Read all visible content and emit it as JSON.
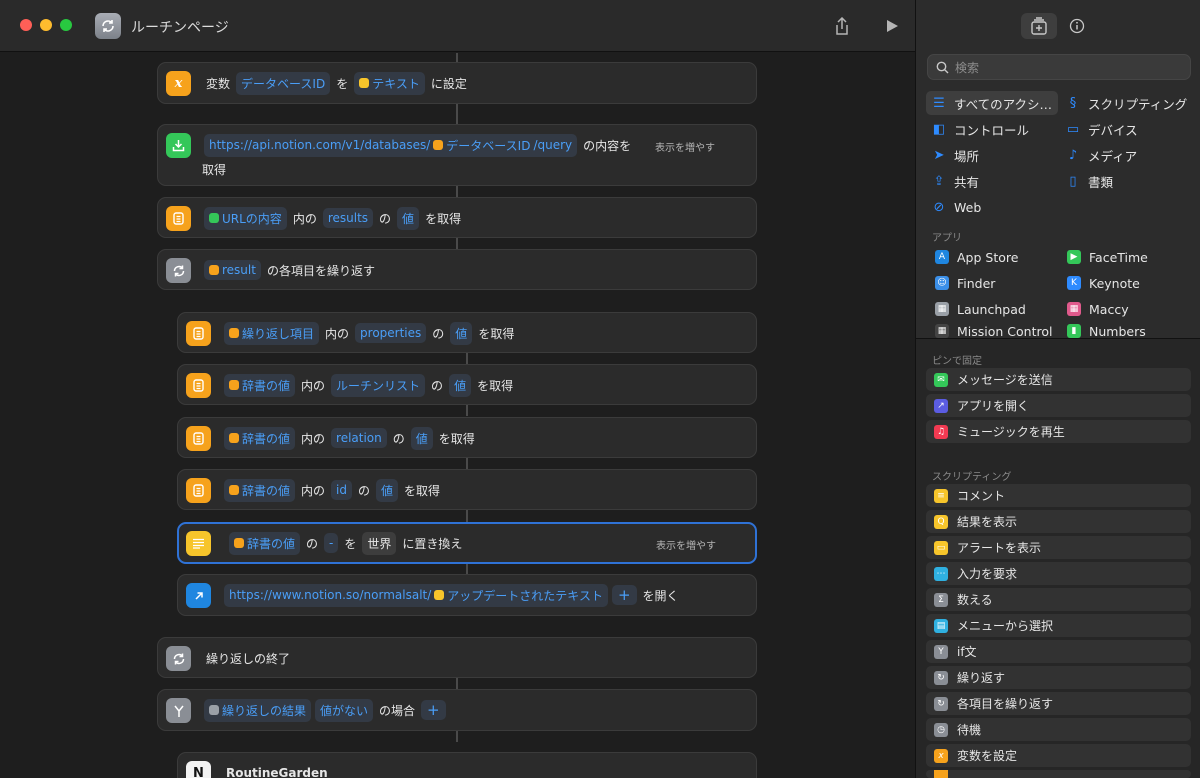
{
  "window": {
    "title": "ルーチンページ"
  },
  "actions": {
    "set_variable": {
      "label1": "変数",
      "var": "データベースID",
      "label2": "を",
      "value": "テキスト",
      "label3": "に設定"
    },
    "get_url": {
      "url": "https://api.notion.com/v1/databases/",
      "var": "データベースID",
      "suffix": "/query",
      "label1": "の内容を",
      "label2": "取得",
      "more": "表示を増やす"
    },
    "get_dict_results": {
      "var": "URLの内容",
      "label1": "内の",
      "key": "results",
      "label2": "の",
      "kind": "値",
      "label3": "を取得"
    },
    "repeat_each": {
      "var": "result",
      "label": "の各項目を繰り返す"
    },
    "get_properties": {
      "var": "繰り返し項目",
      "label1": "内の",
      "key": "properties",
      "label2": "の",
      "kind": "値",
      "label3": "を取得"
    },
    "get_routine_list": {
      "var": "辞書の値",
      "label1": "内の",
      "key": "ルーチンリスト",
      "label2": "の",
      "kind": "値",
      "label3": "を取得"
    },
    "get_relation": {
      "var": "辞書の値",
      "label1": "内の",
      "key": "relation",
      "label2": "の",
      "kind": "値",
      "label3": "を取得"
    },
    "get_id": {
      "var": "辞書の値",
      "label1": "内の",
      "key": "id",
      "label2": "の",
      "kind": "値",
      "label3": "を取得"
    },
    "replace_text": {
      "var": "辞書の値",
      "label1": "の",
      "find": "-",
      "label2": "を",
      "replace": "世界",
      "label3": "に置き換え",
      "more": "表示を増やす"
    },
    "open_url": {
      "url": "https://www.notion.so/normalsalt/",
      "var": "アップデートされたテキスト",
      "label": "を開く"
    },
    "end_repeat": {
      "label": "繰り返しの終了"
    },
    "if_block": {
      "var": "繰り返しの結果",
      "cond": "値がない",
      "label": "の場合"
    },
    "routine_garden": {
      "label": "RoutineGarden"
    }
  },
  "sidebar": {
    "search_placeholder": "検索",
    "categories": [
      {
        "label": "すべてのアクシ…",
        "icon": "list-icon"
      },
      {
        "label": "スクリプティング",
        "icon": "script-icon"
      },
      {
        "label": "コントロール",
        "icon": "toggle-icon"
      },
      {
        "label": "デバイス",
        "icon": "display-icon"
      },
      {
        "label": "場所",
        "icon": "location-icon"
      },
      {
        "label": "メディア",
        "icon": "music-icon"
      },
      {
        "label": "共有",
        "icon": "share-icon"
      },
      {
        "label": "書類",
        "icon": "doc-icon"
      },
      {
        "label": "Web",
        "icon": "compass-icon"
      }
    ],
    "apps_label": "アプリ",
    "apps": [
      {
        "label": "App Store",
        "color": "#1f86e0"
      },
      {
        "label": "FaceTime",
        "color": "#34c759"
      },
      {
        "label": "Finder",
        "color": "#3b8fe8"
      },
      {
        "label": "Keynote",
        "color": "#2e8bff"
      },
      {
        "label": "Launchpad",
        "color": "#9aa0a7"
      },
      {
        "label": "Maccy",
        "color": "#e05a8c"
      },
      {
        "label": "Mission Control",
        "color": "#444444"
      },
      {
        "label": "Numbers",
        "color": "#34c759"
      }
    ],
    "pinned_label": "ピンで固定",
    "pinned": [
      {
        "label": "メッセージを送信",
        "color": "#34c759"
      },
      {
        "label": "アプリを開く",
        "color": "#5b5ce2"
      },
      {
        "label": "ミュージックを再生",
        "color": "#f23a52"
      }
    ],
    "scripting_label": "スクリプティング",
    "scripting": [
      {
        "label": "コメント",
        "color": "#f7c52b"
      },
      {
        "label": "結果を表示",
        "color": "#f7c52b"
      },
      {
        "label": "アラートを表示",
        "color": "#f7c52b"
      },
      {
        "label": "入力を要求",
        "color": "#2fb0e0"
      },
      {
        "label": "数える",
        "color": "#8a8e95"
      },
      {
        "label": "メニューから選択",
        "color": "#2fb0e0"
      },
      {
        "label": "if文",
        "color": "#8a8e95"
      },
      {
        "label": "繰り返す",
        "color": "#8a8e95"
      },
      {
        "label": "各項目を繰り返す",
        "color": "#8a8e95"
      },
      {
        "label": "待機",
        "color": "#8a8e95"
      },
      {
        "label": "変数を設定",
        "color": "#f6a21c"
      }
    ]
  }
}
